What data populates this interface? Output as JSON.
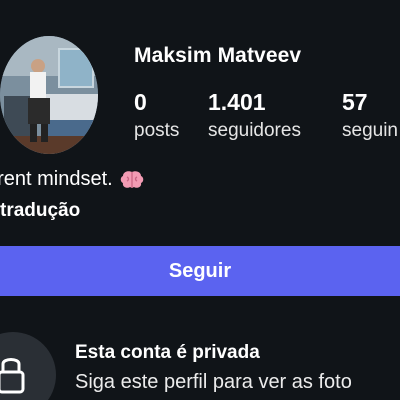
{
  "profile": {
    "username": "Maksim Matveev",
    "stats": [
      {
        "value": "0",
        "label": "posts"
      },
      {
        "value": "1.401",
        "label": "seguidores"
      },
      {
        "value": "57",
        "label": "seguin"
      }
    ],
    "bio_line1": "erent mindset.",
    "bio_line2": "tradução"
  },
  "actions": {
    "follow_label": "Seguir"
  },
  "private_notice": {
    "title": "Esta conta é privada",
    "subtitle": "Siga este perfil para ver as foto"
  },
  "colors": {
    "background": "#101418",
    "button": "#5b63f0",
    "lock_circle": "#2a2f35"
  },
  "icons": {
    "bio_emoji": "brain-icon",
    "private": "lock-icon"
  }
}
